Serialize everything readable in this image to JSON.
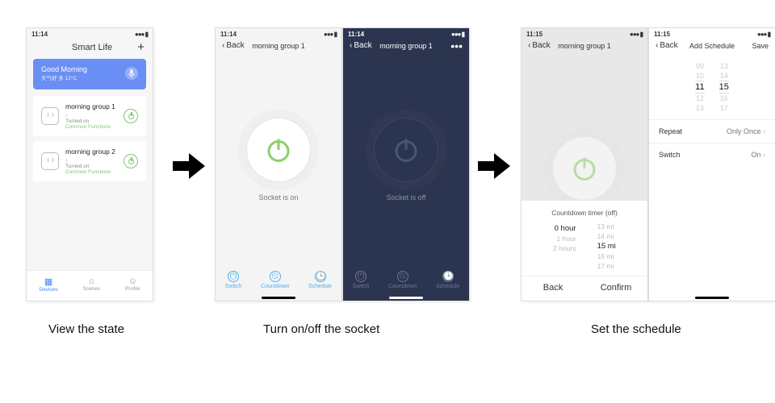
{
  "captions": {
    "view": "View the state",
    "toggle": "Turn on/off the socket",
    "schedule": "Set the schedule"
  },
  "times": {
    "t1": "11:14",
    "t2": "11:14",
    "t3": "11:14",
    "t4": "11:15",
    "t5": "11:15"
  },
  "p1": {
    "title": "Smart Life",
    "weather": {
      "greeting": "Good Morning",
      "sub": "天气好 多 12°C"
    },
    "devices": [
      {
        "name": "morning group 1",
        "status": "Turned on",
        "cf": "Common Functions"
      },
      {
        "name": "morning group 2",
        "status": "Turned on",
        "cf": "Common Functions"
      }
    ],
    "tabs": {
      "devices": "Devices",
      "scenes": "Scenes",
      "profile": "Profile"
    }
  },
  "nav": {
    "back": "Back",
    "title": "morning group 1",
    "more": "•••"
  },
  "socket": {
    "on": "Socket is on",
    "off": "Socket is off"
  },
  "btabs": {
    "switch": "Switch",
    "countdown": "Countdown",
    "schedule": "Schedule"
  },
  "countdown": {
    "title": "Countdown timer (off)",
    "hours": [
      "",
      "0 hour",
      "1 hour",
      "2 hours"
    ],
    "mins": [
      "13 mi",
      "14 mi",
      "15 mi",
      "16 mi",
      "17 mi"
    ],
    "back": "Back",
    "confirm": "Confirm"
  },
  "addSchedule": {
    "title": "Add Schedule",
    "save": "Save",
    "hh": [
      "09",
      "10",
      "11",
      "12",
      "13"
    ],
    "mm": [
      "13",
      "14",
      "15",
      "16",
      "17"
    ],
    "repeat_k": "Repeat",
    "repeat_v": "Only Once",
    "switch_k": "Switch",
    "switch_v": "On"
  }
}
